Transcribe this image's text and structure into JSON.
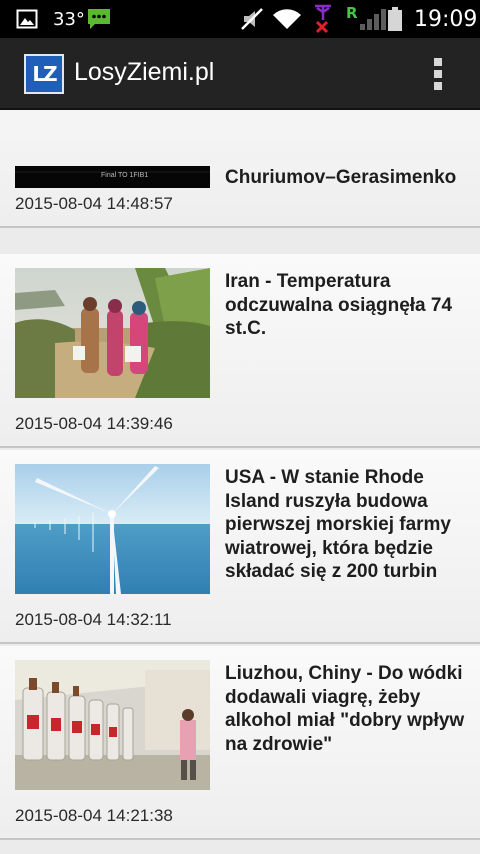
{
  "status_bar": {
    "temperature": "33°",
    "time": "19:09",
    "icons": [
      "image-notification-icon",
      "chat-notification-icon",
      "mute-icon",
      "wifi-icon",
      "no-sim-icon",
      "roaming-signal-icon",
      "battery-icon"
    ],
    "roaming_label": "R"
  },
  "app_bar": {
    "logo_text": "LZ",
    "title": "LosyZiemi.pl",
    "menu_icon": "overflow-menu-icon"
  },
  "news": [
    {
      "title": "Churiumov–Gerasimenko",
      "date": "2015-08-04 14:48:57",
      "image": "comet-thumbnail",
      "thumb_caption": "Final TO 1FIB1"
    },
    {
      "title": "Iran - Temperatura odczuwalna osiągnęła 74 st.C.",
      "date": "2015-08-04 14:39:46",
      "image": "women-carrying-water-photo"
    },
    {
      "title": "USA - W stanie Rhode Island ruszyła budowa pierwszej morskiej farmy wiatrowej, która będzie składać się z 200 turbin",
      "date": "2015-08-04 14:32:11",
      "image": "offshore-wind-farm-photo"
    },
    {
      "title": "Liuzhou, Chiny - Do wódki dodawali viagrę, żeby alkohol miał \"dobry wpływ na zdrowie\"",
      "date": "2015-08-04 14:21:38",
      "image": "vodka-shelves-photo"
    }
  ]
}
